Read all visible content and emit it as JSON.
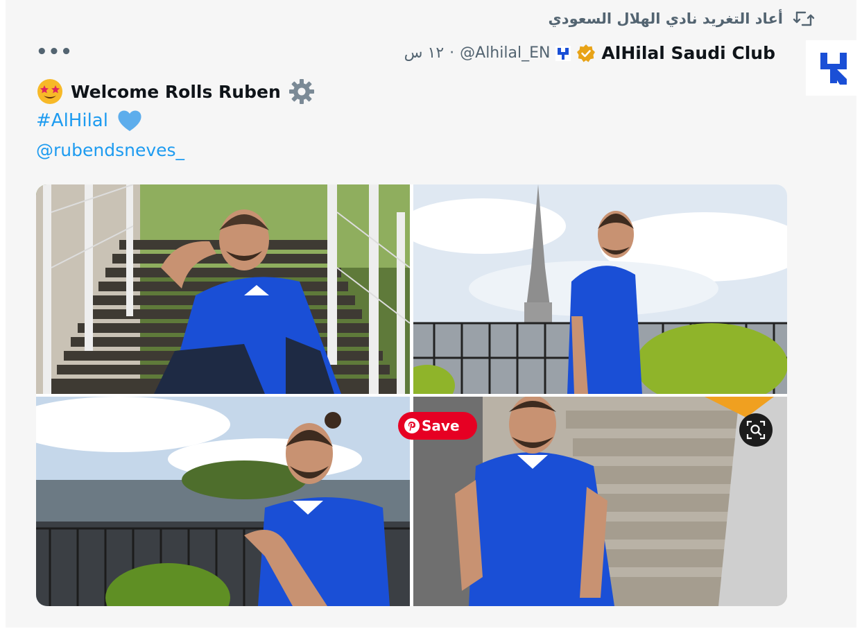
{
  "retweet": {
    "text": "أعاد التغريد نادي الهلال السعودي",
    "icon": "retweet-icon"
  },
  "author": {
    "name": "AlHilal Saudi Club",
    "handle": "@Alhilal_EN",
    "separator": "·",
    "time": "١٢ س",
    "verified_color": "#e8a317",
    "avatar_icon": "alhilal-crest-icon"
  },
  "tweet": {
    "line1": "Welcome Rolls Ruben",
    "line1_emoji": "star-struck-emoji-icon",
    "line1_trailing_icon": "gear-icon",
    "hashtag": "#AlHilal",
    "hashtag_trailing_icon": "blue-heart-icon",
    "mention": "@rubendsneves_"
  },
  "overlay": {
    "save_label": "Save",
    "save_icon": "pinterest-icon",
    "lens_icon": "visual-search-icon"
  },
  "more_label": "•••",
  "colors": {
    "link": "#1d9bf0",
    "jersey": "#1a4fd6",
    "pinterest": "#e60023",
    "muted": "#536471"
  }
}
